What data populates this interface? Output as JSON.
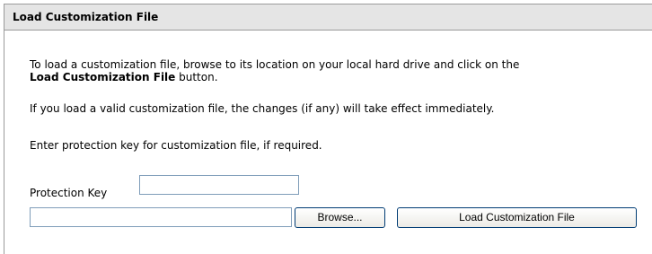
{
  "panel": {
    "title": "Load Customization File"
  },
  "instructions": {
    "line1": "To load a customization file, browse to its location on your local hard drive and click on the",
    "line2_bold": "Load Customization File",
    "line2_rest": " button.",
    "valid_note": "If you load a valid customization file, the changes (if any) will take effect immediately.",
    "key_note": "Enter protection key for customization file, if required."
  },
  "form": {
    "protection_key_label": "Protection Key",
    "protection_key_value": "",
    "file_path_value": "",
    "browse_label": "Browse...",
    "load_label": "Load Customization File"
  }
}
